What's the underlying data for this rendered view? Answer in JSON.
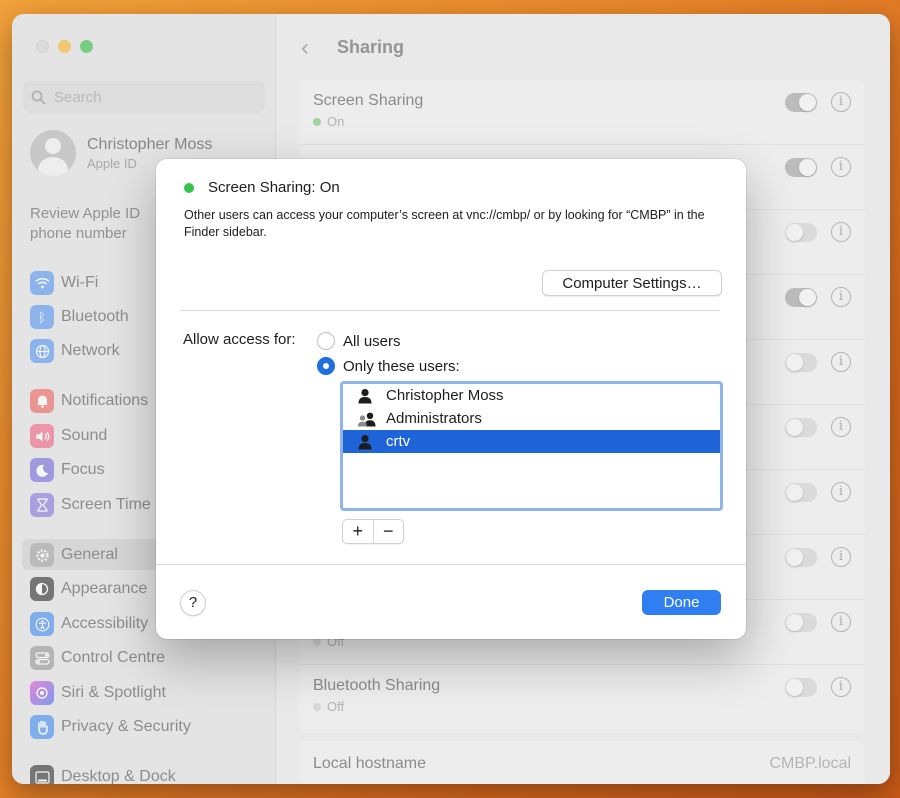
{
  "sidebar": {
    "search_placeholder": "Search",
    "account": {
      "name": "Christopher Moss",
      "sub": "Apple ID"
    },
    "review": "Review Apple ID phone number",
    "items": [
      {
        "label": "Wi-Fi",
        "icon": "wifi-icon",
        "color": "#4a8ff5"
      },
      {
        "label": "Bluetooth",
        "icon": "bluetooth-icon",
        "color": "#4a8ff5"
      },
      {
        "label": "Network",
        "icon": "globe-icon",
        "color": "#4a8ff5"
      },
      {
        "label": "Notifications",
        "icon": "bell-icon",
        "color": "#f25b59"
      },
      {
        "label": "Sound",
        "icon": "speaker-icon",
        "color": "#f25b7a"
      },
      {
        "label": "Focus",
        "icon": "moon-icon",
        "color": "#6b5fd8"
      },
      {
        "label": "Screen Time",
        "icon": "hourglass-icon",
        "color": "#7a68d8"
      },
      {
        "label": "General",
        "icon": "gear-icon",
        "color": "#9a9a9a"
      },
      {
        "label": "Appearance",
        "icon": "appearance-icon",
        "color": "#2c2c2c"
      },
      {
        "label": "Accessibility",
        "icon": "accessibility-icon",
        "color": "#3d8ef0"
      },
      {
        "label": "Control Centre",
        "icon": "control-centre-icon",
        "color": "#8c8c8c"
      },
      {
        "label": "Siri & Spotlight",
        "icon": "siri-icon",
        "color": "#c34fd0"
      },
      {
        "label": "Privacy & Security",
        "icon": "hand-icon",
        "color": "#3d8ef0"
      },
      {
        "label": "Desktop & Dock",
        "icon": "dock-icon",
        "color": "#333333"
      }
    ]
  },
  "main": {
    "title": "Sharing",
    "rows": [
      {
        "label": "Screen Sharing",
        "status": "On",
        "on": true
      },
      {
        "label": "",
        "status": "",
        "on": true
      },
      {
        "label": "",
        "status": "",
        "on": false
      },
      {
        "label": "",
        "status": "",
        "on": true
      },
      {
        "label": "",
        "status": "",
        "on": false
      },
      {
        "label": "",
        "status": "",
        "on": false
      },
      {
        "label": "",
        "status": "",
        "on": false
      },
      {
        "label": "",
        "status": "",
        "on": false
      },
      {
        "label": "",
        "status": "Off",
        "on": false
      },
      {
        "label": "Bluetooth Sharing",
        "status": "Off",
        "on": false
      }
    ],
    "hostname_label": "Local hostname",
    "hostname_value": "CMBP.local"
  },
  "dialog": {
    "status": "Screen Sharing: On",
    "description": "Other users can access your computer’s screen at vnc://cmbp/ or by looking for “CMBP” in the Finder sidebar.",
    "computer_settings": "Computer Settings…",
    "allow_label": "Allow access for:",
    "option_all": "All users",
    "option_only": "Only these users:",
    "users": [
      {
        "name": "Christopher Moss",
        "icon": "user-icon",
        "selected": false
      },
      {
        "name": "Administrators",
        "icon": "group-icon",
        "selected": false
      },
      {
        "name": "crtv",
        "icon": "user-icon",
        "selected": true
      }
    ],
    "add": "+",
    "remove": "−",
    "help": "?",
    "done": "Done"
  }
}
